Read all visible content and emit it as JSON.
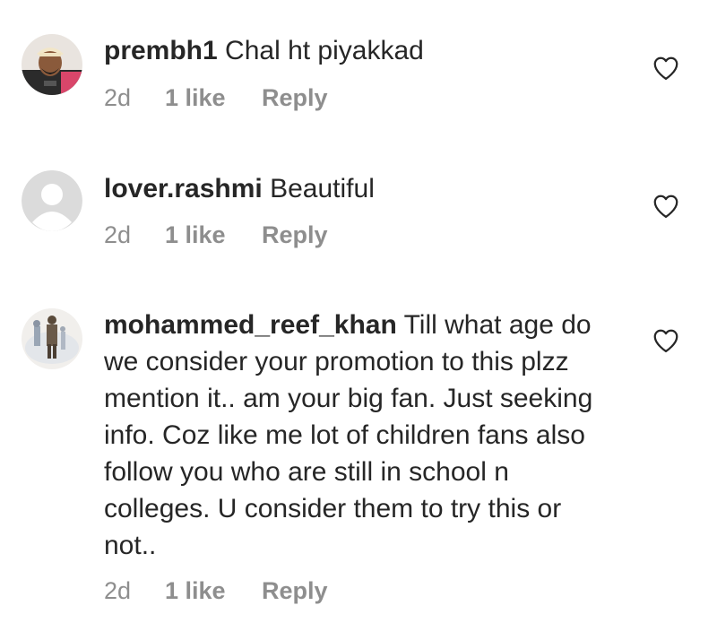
{
  "comments": [
    {
      "username": "prembh1",
      "text": "Chal ht piyakkad",
      "time": "2d",
      "likes": "1 like",
      "reply": "Reply"
    },
    {
      "username": "lover.rashmi",
      "text": "Beautiful",
      "time": "2d",
      "likes": "1 like",
      "reply": "Reply"
    },
    {
      "username": "mohammed_reef_khan",
      "text": "Till what age do we consider your promotion to this plzz mention it.. am your big fan. Just seeking info. Coz like me lot of children fans also follow you who are still in school n colleges. U consider them to try this or not..",
      "time": "2d",
      "likes": "1 like",
      "reply": "Reply"
    }
  ],
  "colors": {
    "text": "#262626",
    "meta": "#8e8e8e",
    "placeholder_avatar": "#dbdbdb"
  }
}
